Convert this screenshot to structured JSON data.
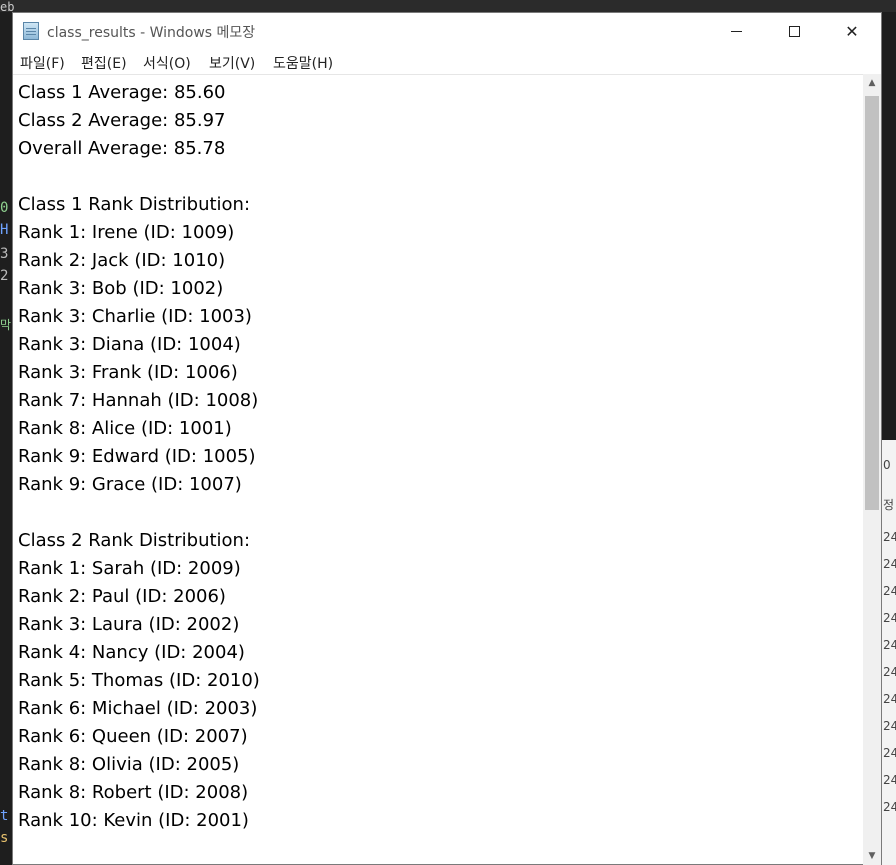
{
  "window": {
    "title": "class_results - Windows 메모장",
    "icon": "notepad-icon"
  },
  "controls": {
    "minimize_icon": "minimize-icon",
    "maximize_icon": "maximize-icon",
    "close_glyph": "✕"
  },
  "menu": [
    "파일(F)",
    "편집(E)",
    "서식(O)",
    "보기(V)",
    "도움말(H)"
  ],
  "content": {
    "lines": [
      "Class 1 Average: 85.60",
      "Class 2 Average: 85.97",
      "Overall Average: 85.78",
      "",
      "Class 1 Rank Distribution:",
      "Rank 1: Irene (ID: 1009)",
      "Rank 2: Jack (ID: 1010)",
      "Rank 3: Bob (ID: 1002)",
      "Rank 3: Charlie (ID: 1003)",
      "Rank 3: Diana (ID: 1004)",
      "Rank 3: Frank (ID: 1006)",
      "Rank 7: Hannah (ID: 1008)",
      "Rank 8: Alice (ID: 1001)",
      "Rank 9: Edward (ID: 1005)",
      "Rank 9: Grace (ID: 1007)",
      "",
      "Class 2 Rank Distribution:",
      "Rank 1: Sarah (ID: 2009)",
      "Rank 2: Paul (ID: 2006)",
      "Rank 3: Laura (ID: 2002)",
      "Rank 4: Nancy (ID: 2004)",
      "Rank 5: Thomas (ID: 2010)",
      "Rank 6: Michael (ID: 2003)",
      "Rank 6: Queen (ID: 2007)",
      "Rank 8: Olivia (ID: 2005)",
      "Rank 8: Robert (ID: 2008)",
      "Rank 10: Kevin (ID: 2001)"
    ]
  },
  "scrollbar": {
    "up_glyph": "▲",
    "down_glyph": "▼"
  },
  "background": {
    "left_fragments": [
      "eb",
      "0",
      "H",
      "3",
      "2",
      "막",
      "t",
      "s"
    ],
    "right_fragments": [
      "정",
      "24",
      "24",
      "24",
      "24",
      "24",
      "24",
      "24",
      "24",
      "24",
      "24",
      "24"
    ],
    "right_paren": "0"
  },
  "colors": {
    "window_bg": "#ffffff",
    "desktop_bg": "#1e1e1e",
    "text": "#000000",
    "scroll_thumb": "#c1c1c1"
  }
}
